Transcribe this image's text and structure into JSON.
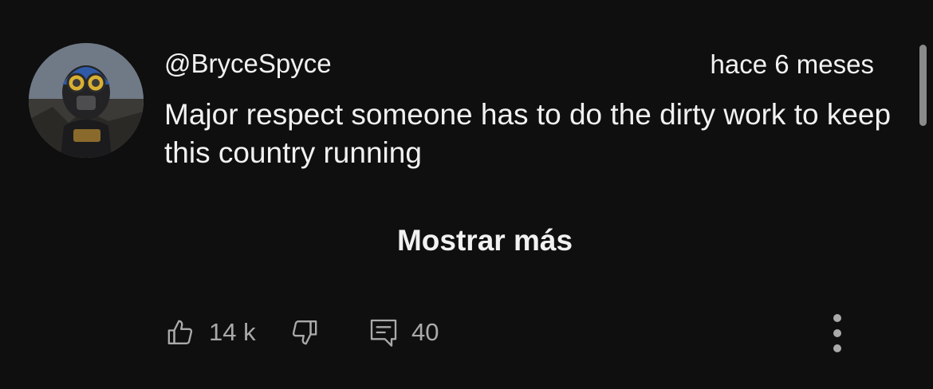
{
  "comment": {
    "author": "@BryceSpyce",
    "time": "hace 6 meses",
    "text": "Major respect someone has to do the dirty work to keep this country running",
    "show_more_label": "Mostrar más"
  },
  "actions": {
    "likes": "14 k",
    "replies": "40",
    "like_icon": "thumbs-up-icon",
    "dislike_icon": "thumbs-down-icon",
    "reply_icon": "comment-icon",
    "more_icon": "more-vertical-icon"
  },
  "colors": {
    "background": "#0f0f0f",
    "primary_text": "#f1f1f1",
    "secondary_text": "#aaaaaa"
  }
}
